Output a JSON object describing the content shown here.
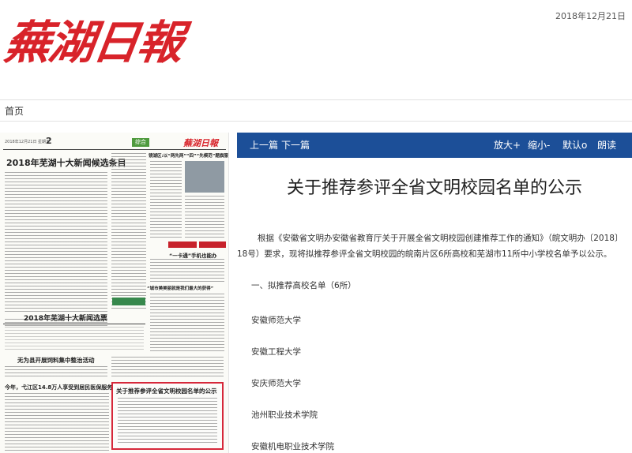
{
  "masthead": {
    "logo_text": "蕪湖日報",
    "date": "2018年12月21日"
  },
  "nav": {
    "home": "首页"
  },
  "newspaper_thumbnail": {
    "header_date": "2018年12月21日 星期五",
    "page_number": "2",
    "section_tag": "综合",
    "mini_logo": "蕪湖日報",
    "headline_1": "2018年芜湖十大新闻候选条目",
    "headline_2": "2018年芜湖十大新闻选票",
    "headline_3": "无为县开展饲料集中整治活动",
    "headline_4": "今年，弋江区14.8万人享受到居民医保服务",
    "headline_5": "关于推荐参评全省文明校园名单的公示",
    "headline_6": "“城市美美丽就是我们最大的获得”",
    "headline_7": "“一卡通”手机也能办",
    "headline_8": "镜湖区:以“两先两”“四”“先模范”题旗服务“零距离”"
  },
  "toolbar": {
    "prev": "上一篇",
    "next": "下一篇",
    "zoom_in": "放大+",
    "zoom_out": "缩小-",
    "read_mode": "默认",
    "read_mode_icon": "o",
    "speak": "朗读"
  },
  "article": {
    "title": "关于推荐参评全省文明校园名单的公示",
    "paragraphs": [
      "根据《安徽省文明办安徽省教育厅关于开展全省文明校园创建推荐工作的通知》（皖文明办〔2018〕18号）要求，现将拟推荐参评全省文明校园的皖南片区6所高校和芜湖市11所中小学校名单予以公示。",
      "一、拟推荐高校名单（6所）",
      "安徽师范大学",
      "安徽工程大学",
      "安庆师范大学",
      "池州职业技术学院",
      "安徽机电职业技术学院"
    ]
  },
  "colors": {
    "brand_red": "#d8232a",
    "toolbar_blue": "#1c4f98",
    "highlight_red": "#d6283a"
  }
}
